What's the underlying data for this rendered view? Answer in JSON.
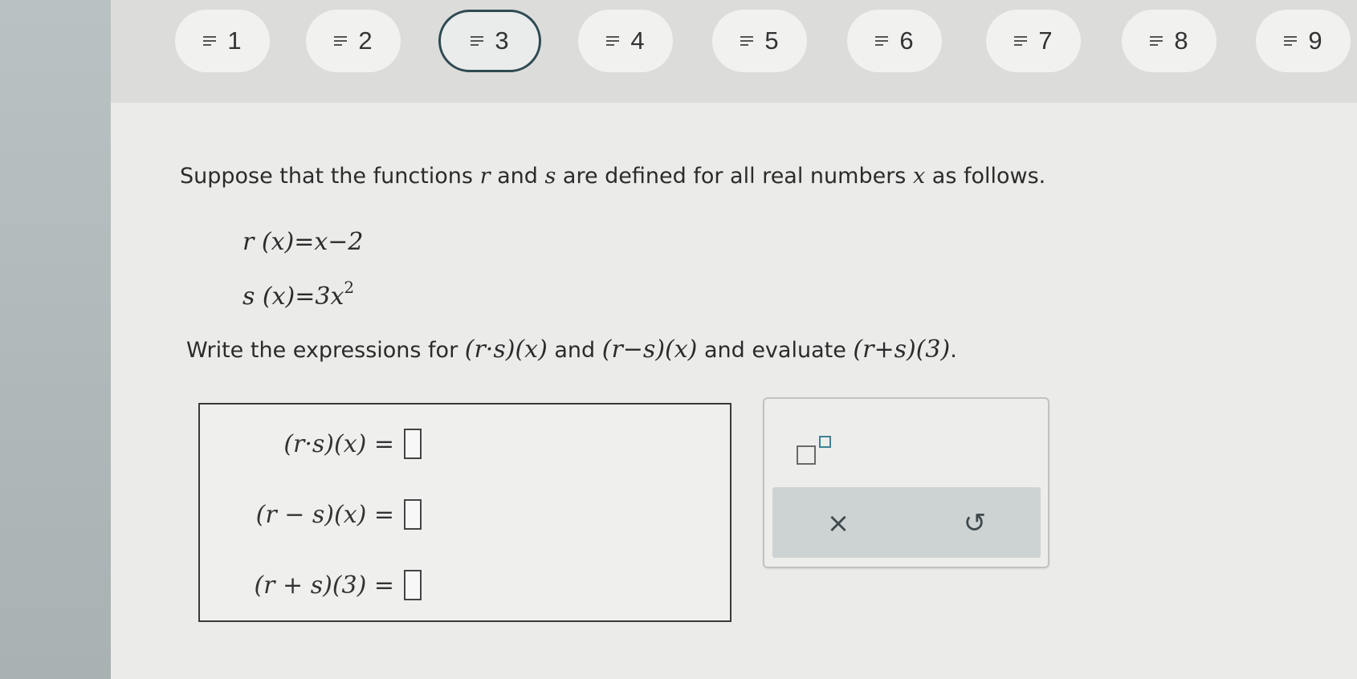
{
  "question_nav": {
    "items": [
      {
        "label": "1"
      },
      {
        "label": "2"
      },
      {
        "label": "3"
      },
      {
        "label": "4"
      },
      {
        "label": "5"
      },
      {
        "label": "6"
      },
      {
        "label": "7"
      },
      {
        "label": "8"
      },
      {
        "label": "9"
      }
    ],
    "active_index": 2,
    "icon": "list-icon"
  },
  "problem": {
    "intro_1": "Suppose that the functions ",
    "var_r": "r",
    "and": " and ",
    "var_s": "s",
    "intro_2": " are defined for all real numbers ",
    "var_x": "x",
    "intro_3": " as follows.",
    "def_r": "r (x)=x−2",
    "def_s_base": "s (x)=3x",
    "def_s_exp": "2",
    "instr_1": "Write the expressions for ",
    "expr_1": "(r·s)(x)",
    "instr_and": " and ",
    "expr_2": "(r−s)(x)",
    "instr_2": " and evaluate ",
    "expr_3": "(r+s)(3)",
    "instr_end": "."
  },
  "answers": [
    {
      "label": "(r·s)(x) =",
      "value": ""
    },
    {
      "label": "(r − s)(x) =",
      "value": ""
    },
    {
      "label": "(r + s)(3) =",
      "value": ""
    }
  ],
  "toolpad": {
    "exponent_icon": "exponent-template-icon",
    "clear_symbol": "×",
    "undo_symbol": "↺"
  },
  "colors": {
    "active_border": "#2f4a52",
    "tool_strip": "#cdd3d3",
    "exponent_accent": "#3f7f95"
  }
}
